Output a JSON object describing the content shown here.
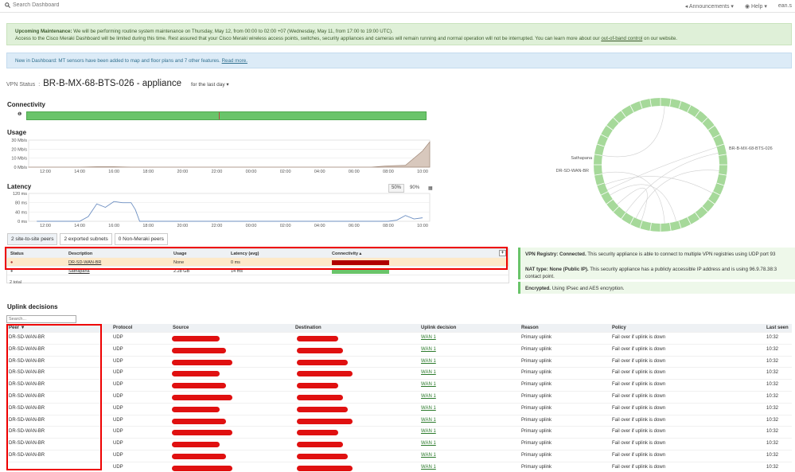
{
  "topbar": {
    "search_placeholder": "Search Dashboard",
    "announcements": "Announcements",
    "help": "Help",
    "user": "ean.s"
  },
  "banners": {
    "maintenance_title": "Upcoming Maintenance:",
    "maintenance_line1": "We will be performing routine system maintenance on Thursday, May 12, from 00:00 to 02:00 +07 (Wednesday, May 11, from 17:00 to 19:00 UTC).",
    "maintenance_line2": "Access to the Cisco Meraki Dashboard will be limited during this time. Rest assured that your Cisco Meraki wireless access points, switches, security appliances and cameras will remain running and normal operation will not be interrupted. You can learn more about our",
    "maintenance_link": "out-of-band control",
    "maintenance_tail": "on our website.",
    "new_text": "New in Dashboard: MT sensors have been added to map and floor plans and 7 other features.",
    "new_link": "Read more."
  },
  "vpn": {
    "label": "VPN Status",
    "title": "BR-B-MX-68-BTS-026 - appliance",
    "timeframe": "for the last day"
  },
  "sections": {
    "connectivity": "Connectivity",
    "usage": "Usage",
    "latency": "Latency",
    "uplink_decisions": "Uplink decisions"
  },
  "usage_chart": {
    "y_ticks": [
      "30 Mb/s",
      "20 Mb/s",
      "10 Mb/s",
      "0 Mb/s"
    ],
    "x_ticks": [
      "12:00",
      "14:00",
      "16:00",
      "18:00",
      "20:00",
      "22:00",
      "00:00",
      "02:00",
      "04:00",
      "06:00",
      "08:00",
      "10:00"
    ]
  },
  "latency_chart": {
    "y_ticks": [
      "120 ms",
      "80 ms",
      "40 ms",
      "0 ms"
    ],
    "x_ticks": [
      "12:00",
      "14:00",
      "16:00",
      "18:00",
      "20:00",
      "22:00",
      "00:00",
      "02:00",
      "04:00",
      "06:00",
      "08:00",
      "10:00"
    ],
    "percentile_options": [
      "50%",
      "90%"
    ]
  },
  "chart_data": [
    {
      "type": "area",
      "x": [
        "11:00",
        "12:00",
        "13:00",
        "14:00",
        "15:00",
        "16:00",
        "17:00",
        "18:00",
        "19:00",
        "20:00",
        "21:00",
        "22:00",
        "23:00",
        "00:00",
        "01:00",
        "02:00",
        "03:00",
        "04:00",
        "05:00",
        "06:00",
        "07:00",
        "08:00",
        "09:00",
        "10:00",
        "10:30"
      ],
      "values": [
        0,
        0,
        0,
        0,
        0.5,
        0.5,
        0,
        0,
        0,
        0,
        0,
        0,
        0,
        0,
        0,
        0,
        0,
        0,
        0,
        0,
        0,
        1.5,
        2,
        18,
        28
      ],
      "ylabel": "",
      "ylim": [
        0,
        30
      ]
    },
    {
      "type": "line",
      "x": [
        "11:30",
        "12:00",
        "13:00",
        "13:30",
        "14:00",
        "14:30",
        "15:00",
        "15:30",
        "16:00",
        "16:30",
        "17:00",
        "17:15",
        "17:30",
        "18:00",
        "22:00",
        "02:00",
        "06:00",
        "08:00",
        "08:30",
        "09:00",
        "09:30",
        "10:00"
      ],
      "values": [
        0,
        0,
        0,
        0,
        0,
        20,
        75,
        60,
        85,
        80,
        80,
        50,
        0,
        0,
        0,
        0,
        0,
        0,
        5,
        25,
        10,
        15
      ],
      "ylabel": "",
      "ylim": [
        0,
        120
      ]
    }
  ],
  "peer_tabs": [
    "2 site-to-site peers",
    "2 exported subnets",
    "0 Non-Meraki peers"
  ],
  "peer_table": {
    "headers": [
      "Status",
      "Description",
      "Usage",
      "Latency (avg)",
      "Connectivity"
    ],
    "rows": [
      {
        "description": "DR-SD-WAN-BR",
        "usage": "None",
        "latency": "0 ms",
        "status_color": "#b00000"
      },
      {
        "description": "Sathapana",
        "usage": "2.28 GB",
        "latency": "14 ms",
        "status_color": "#6ac46a"
      }
    ],
    "total": "2 total"
  },
  "diagram": {
    "labels": [
      "BR-B-MX-68-BTS-026",
      "Sathapana",
      "DR-SD-WAN-BR"
    ]
  },
  "info": {
    "registry_title": "VPN Registry: Connected.",
    "registry_text": "This security appliance is able to connect to multiple VPN registries using UDP port 93",
    "nat_title": "NAT type: None (Public IP).",
    "nat_text": "This security appliance has a publicly accessible IP address and is using 96.9.78.38:3",
    "nat_text2": "contact point.",
    "enc_title": "Encrypted.",
    "enc_text": "Using IPsec and AES encryption."
  },
  "uplink": {
    "search_placeholder": "Search...",
    "headers": [
      "Peer ▼",
      "Protocol",
      "Source",
      "Destination",
      "Uplink decision",
      "Reason",
      "Policy",
      "Last seen"
    ],
    "rows": [
      {
        "peer": "DR-SD-WAN-BR",
        "protocol": "UDP",
        "uplink": "WAN 1",
        "reason": "Primary uplink",
        "policy": "Fail over if uplink is down",
        "last_seen": "10:32"
      },
      {
        "peer": "DR-SD-WAN-BR",
        "protocol": "UDP",
        "uplink": "WAN 1",
        "reason": "Primary uplink",
        "policy": "Fail over if uplink is down",
        "last_seen": "10:32"
      },
      {
        "peer": "DR-SD-WAN-BR",
        "protocol": "UDP",
        "uplink": "WAN 1",
        "reason": "Primary uplink",
        "policy": "Fail over if uplink is down",
        "last_seen": "10:32"
      },
      {
        "peer": "DR-SD-WAN-BR",
        "protocol": "UDP",
        "uplink": "WAN 1",
        "reason": "Primary uplink",
        "policy": "Fail over if uplink is down",
        "last_seen": "10:32"
      },
      {
        "peer": "DR-SD-WAN-BR",
        "protocol": "UDP",
        "uplink": "WAN 1",
        "reason": "Primary uplink",
        "policy": "Fail over if uplink is down",
        "last_seen": "10:32"
      },
      {
        "peer": "DR-SD-WAN-BR",
        "protocol": "UDP",
        "uplink": "WAN 1",
        "reason": "Primary uplink",
        "policy": "Fail over if uplink is down",
        "last_seen": "10:32"
      },
      {
        "peer": "DR-SD-WAN-BR",
        "protocol": "UDP",
        "uplink": "WAN 1",
        "reason": "Primary uplink",
        "policy": "Fail over if uplink is down",
        "last_seen": "10:32"
      },
      {
        "peer": "DR-SD-WAN-BR",
        "protocol": "UDP",
        "uplink": "WAN 1",
        "reason": "Primary uplink",
        "policy": "Fail over if uplink is down",
        "last_seen": "10:32"
      },
      {
        "peer": "DR-SD-WAN-BR",
        "protocol": "UDP",
        "uplink": "WAN 1",
        "reason": "Primary uplink",
        "policy": "Fail over if uplink is down",
        "last_seen": "10:32"
      },
      {
        "peer": "DR-SD-WAN-BR",
        "protocol": "UDP",
        "uplink": "WAN 1",
        "reason": "Primary uplink",
        "policy": "Fail over if uplink is down",
        "last_seen": "10:32"
      },
      {
        "peer": "DR-SD-WAN-BR",
        "protocol": "UDP",
        "uplink": "WAN 1",
        "reason": "Primary uplink",
        "policy": "Fail over if uplink is down",
        "last_seen": "10:32"
      },
      {
        "peer": "",
        "protocol": "UDP",
        "uplink": "WAN 1",
        "reason": "Primary uplink",
        "policy": "Fail over if uplink is down",
        "last_seen": "10:32"
      }
    ]
  },
  "colors": {
    "connected": "#6ac46a",
    "down": "#b00000",
    "annotation": "#e00000"
  }
}
